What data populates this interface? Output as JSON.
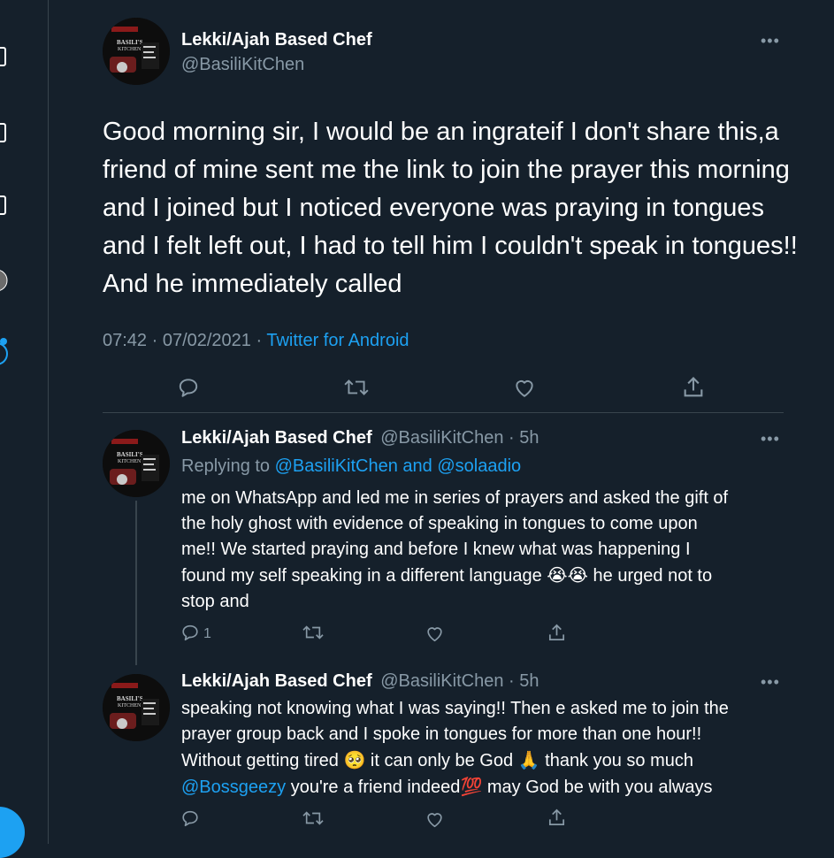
{
  "main_tweet": {
    "author_name": "Lekki/Ajah Based Chef",
    "author_handle": "@BasiliKitChen",
    "text": "Good morning sir, I would be an ingrateif I don't share this,a friend of mine sent me the link to join the prayer this morning and I joined but I noticed everyone was praying in tongues and I felt left out, I had to tell him I couldn't speak in tongues!! And he immediately called",
    "timestamp": "07:42 · 07/02/2021 · ",
    "source": "Twitter for Android"
  },
  "avatar": {
    "brand_line1": "BASILI'S",
    "brand_line2": "KITCHEN",
    "brand_color": "#d9d9d9"
  },
  "reply1": {
    "author_name": "Lekki/Ajah Based Chef",
    "author_handle": "@BasiliKitChen · 5h",
    "replying_prefix": "Replying to ",
    "replying_to": "@BasiliKitChen and @solaadio",
    "lines": [
      "me on WhatsApp and led me in series of prayers and asked the gift of",
      "the holy ghost with evidence of speaking in tongues to come upon",
      "me!! We started praying and before I knew what was happening I"
    ],
    "line4": "found my self speaking in a different language",
    "emoji1": "😭😭",
    "line4_end": " he urged not to",
    "line5": "stop and",
    "reply_count": "1"
  },
  "reply2": {
    "author_name": "Lekki/Ajah Based Chef",
    "author_handle": "@BasiliKitChen · 5h",
    "line1": "speaking not knowing what I was saying!! Then e asked me to join the",
    "line2": "prayer group back and I spoke in tongues for more than one hour!!",
    "line3a": "Without getting tired ",
    "emoji_pleading": "🥺",
    "line3b": " it can only be God ",
    "emoji_pray": "🙏",
    "line3c": " thank you so much",
    "mention": "@Bossgeezy",
    "line4a": "  you're a friend indeed",
    "emoji_100": "💯",
    "line4b": " may God be with you always"
  },
  "more_glyph": "•••",
  "colors": {
    "background": "#15202b",
    "text": "#ffffff",
    "secondary": "#8899a6",
    "accent": "#1da1f2",
    "border": "#38444d"
  },
  "icons": [
    "reply-icon",
    "retweet-icon",
    "like-icon",
    "share-icon",
    "more-icon",
    "avatar"
  ]
}
